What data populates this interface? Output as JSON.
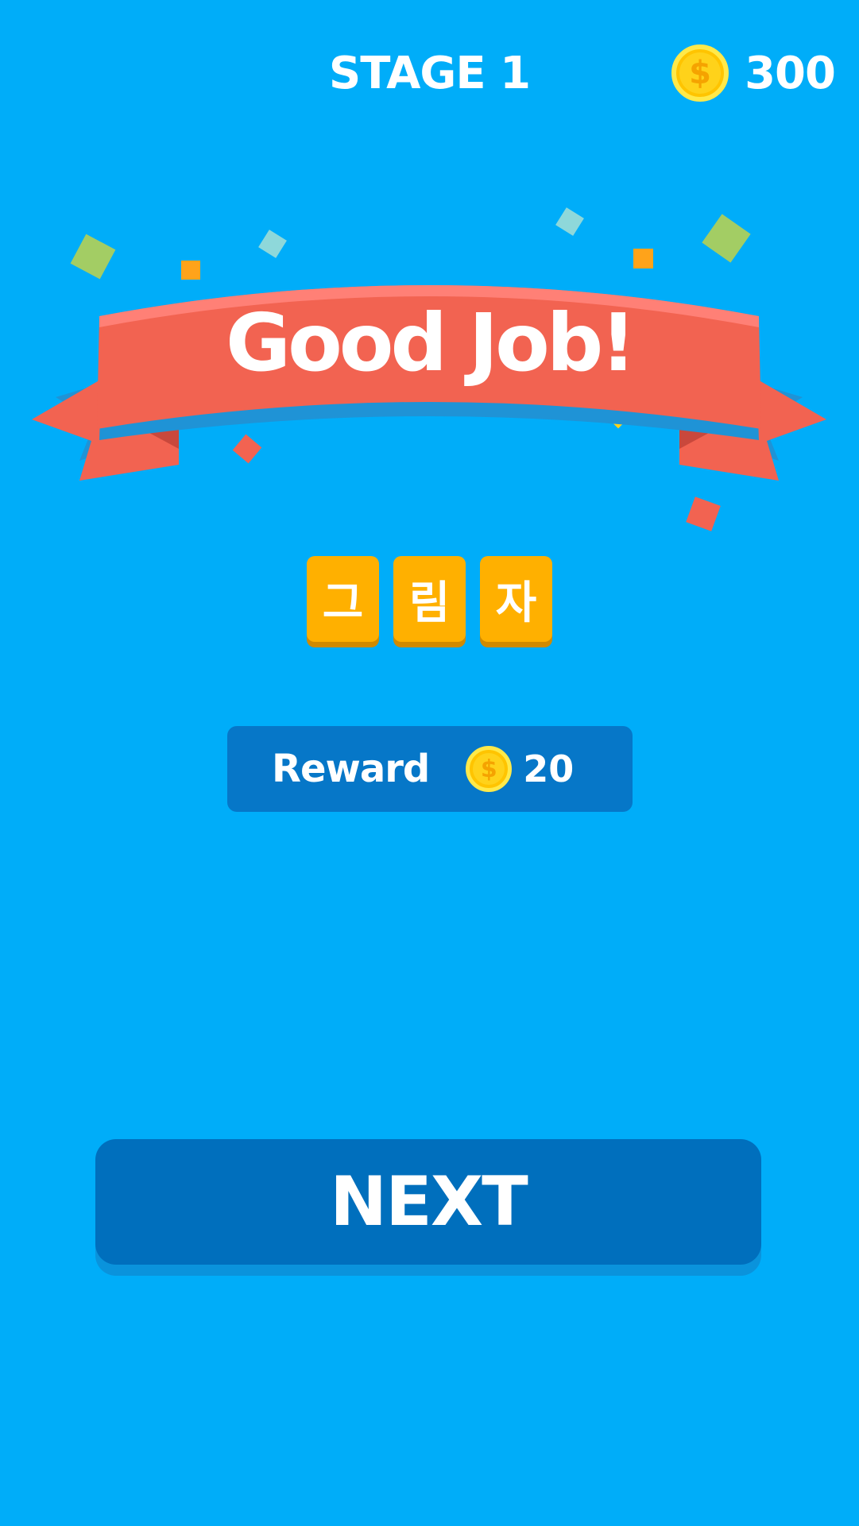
{
  "header": {
    "stage_label": "STAGE 1",
    "coin_total": "300",
    "coin_symbol": "$"
  },
  "banner": {
    "title": "Good Job!"
  },
  "answer": {
    "letters": [
      "그",
      "림",
      "자"
    ]
  },
  "reward": {
    "label": "Reward",
    "coin_symbol": "$",
    "amount": "20"
  },
  "next_button": {
    "label": "NEXT"
  },
  "colors": {
    "background": "#00adf9",
    "banner_red": "#f26351",
    "tile_orange": "#ffb000",
    "reward_box": "#0677c8",
    "next_button": "#006fbd",
    "coin_yellow": "#ffd21a"
  }
}
